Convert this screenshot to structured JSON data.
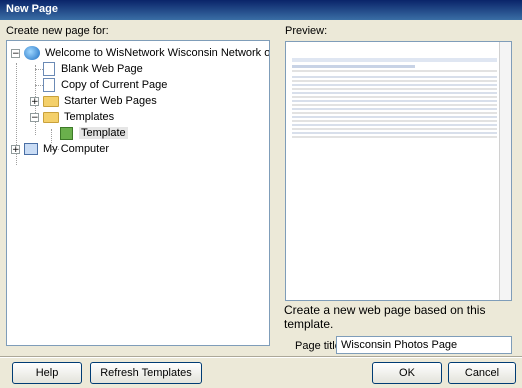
{
  "window": {
    "title": "New Page"
  },
  "labels": {
    "create_for": "Create new page for:",
    "preview": "Preview:",
    "description": "Create a new web page based on this template.",
    "page_title": "Page title:"
  },
  "tree": [
    {
      "label": "Welcome to WisNetwork Wisconsin Network of Web Sit",
      "expander": "−",
      "icon": "website-icon"
    },
    {
      "label": "Blank Web Page",
      "icon": "page-icon"
    },
    {
      "label": "Copy of Current Page",
      "icon": "page-icon"
    },
    {
      "label": "Starter Web Pages",
      "expander": "+",
      "icon": "folder-icon"
    },
    {
      "label": "Templates",
      "expander": "−",
      "icon": "folder-open-icon"
    },
    {
      "label": "Template",
      "icon": "template-icon",
      "selected": true
    },
    {
      "label": "My Computer",
      "expander": "+",
      "icon": "computer-icon"
    }
  ],
  "page_title_value": "Wisconsin Photos Page",
  "buttons": {
    "help": "Help",
    "refresh": "Refresh Templates",
    "ok": "OK",
    "cancel": "Cancel"
  }
}
